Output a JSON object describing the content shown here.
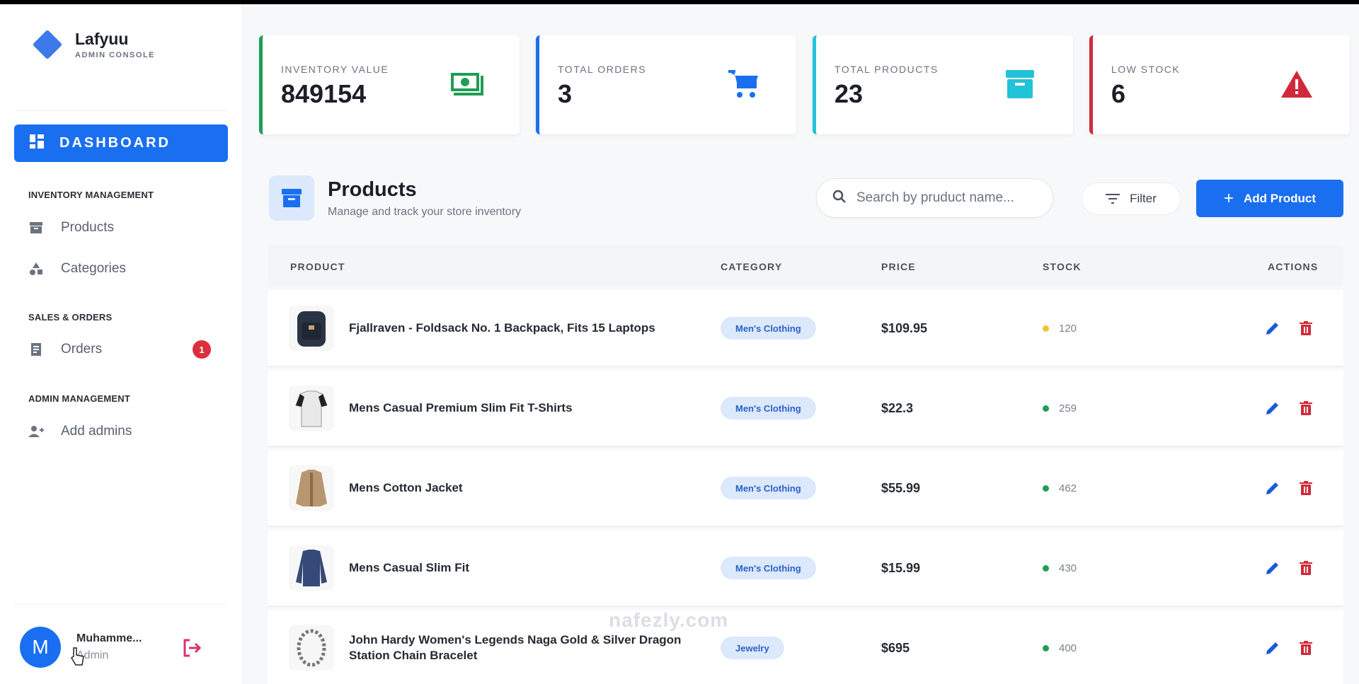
{
  "brand": {
    "name": "Lafyuu",
    "subtitle": "ADMIN CONSOLE"
  },
  "sidebar": {
    "active": {
      "label": "DASHBOARD",
      "icon": "dashboard-icon"
    },
    "sections": [
      {
        "title": "INVENTORY MANAGEMENT",
        "items": [
          {
            "label": "Products",
            "icon": "archive-icon"
          },
          {
            "label": "Categories",
            "icon": "shapes-icon"
          }
        ]
      },
      {
        "title": "SALES & ORDERS",
        "items": [
          {
            "label": "Orders",
            "icon": "receipt-icon",
            "badge": "1"
          }
        ]
      },
      {
        "title": "ADMIN MANAGEMENT",
        "items": [
          {
            "label": "Add admins",
            "icon": "person-add-icon"
          }
        ]
      }
    ],
    "user": {
      "initial": "M",
      "name": "Muhamme...",
      "role": "Admin"
    }
  },
  "stats": [
    {
      "label": "INVENTORY VALUE",
      "value": "849154",
      "color": "#1f9d55",
      "icon": "money-icon"
    },
    {
      "label": "TOTAL ORDERS",
      "value": "3",
      "color": "#1a6ff0",
      "icon": "cart-icon"
    },
    {
      "label": "TOTAL PRODUCTS",
      "value": "23",
      "color": "#22c3d8",
      "icon": "archive-icon"
    },
    {
      "label": "LOW STOCK",
      "value": "6",
      "color": "#d02a3a",
      "icon": "warning-icon"
    }
  ],
  "products_header": {
    "title": "Products",
    "subtitle": "Manage and track your store inventory",
    "search_placeholder": "Search by pruduct name...",
    "filter_label": "Filter",
    "add_label": "Add Product"
  },
  "table": {
    "columns": [
      "PRODUCT",
      "CATEGORY",
      "PRICE",
      "STOCK",
      "ACTIONS"
    ],
    "rows": [
      {
        "name": "Fjallraven - Foldsack No. 1 Backpack, Fits 15 Laptops",
        "category": "Men's Clothing",
        "price": "$109.95",
        "stock": "120",
        "stock_color": "#f2c230",
        "thumb": "backpack"
      },
      {
        "name": "Mens Casual Premium Slim Fit T-Shirts",
        "category": "Men's Clothing",
        "price": "$22.3",
        "stock": "259",
        "stock_color": "#1f9d55",
        "thumb": "tshirt"
      },
      {
        "name": "Mens Cotton Jacket",
        "category": "Men's Clothing",
        "price": "$55.99",
        "stock": "462",
        "stock_color": "#1f9d55",
        "thumb": "jacket"
      },
      {
        "name": "Mens Casual Slim Fit",
        "category": "Men's Clothing",
        "price": "$15.99",
        "stock": "430",
        "stock_color": "#1f9d55",
        "thumb": "longsleeve"
      },
      {
        "name": "John Hardy Women's Legends Naga Gold & Silver Dragon Station Chain Bracelet",
        "category": "Jewelry",
        "price": "$695",
        "stock": "400",
        "stock_color": "#1f9d55",
        "thumb": "bracelet"
      }
    ]
  },
  "watermark": "nafezly.com"
}
